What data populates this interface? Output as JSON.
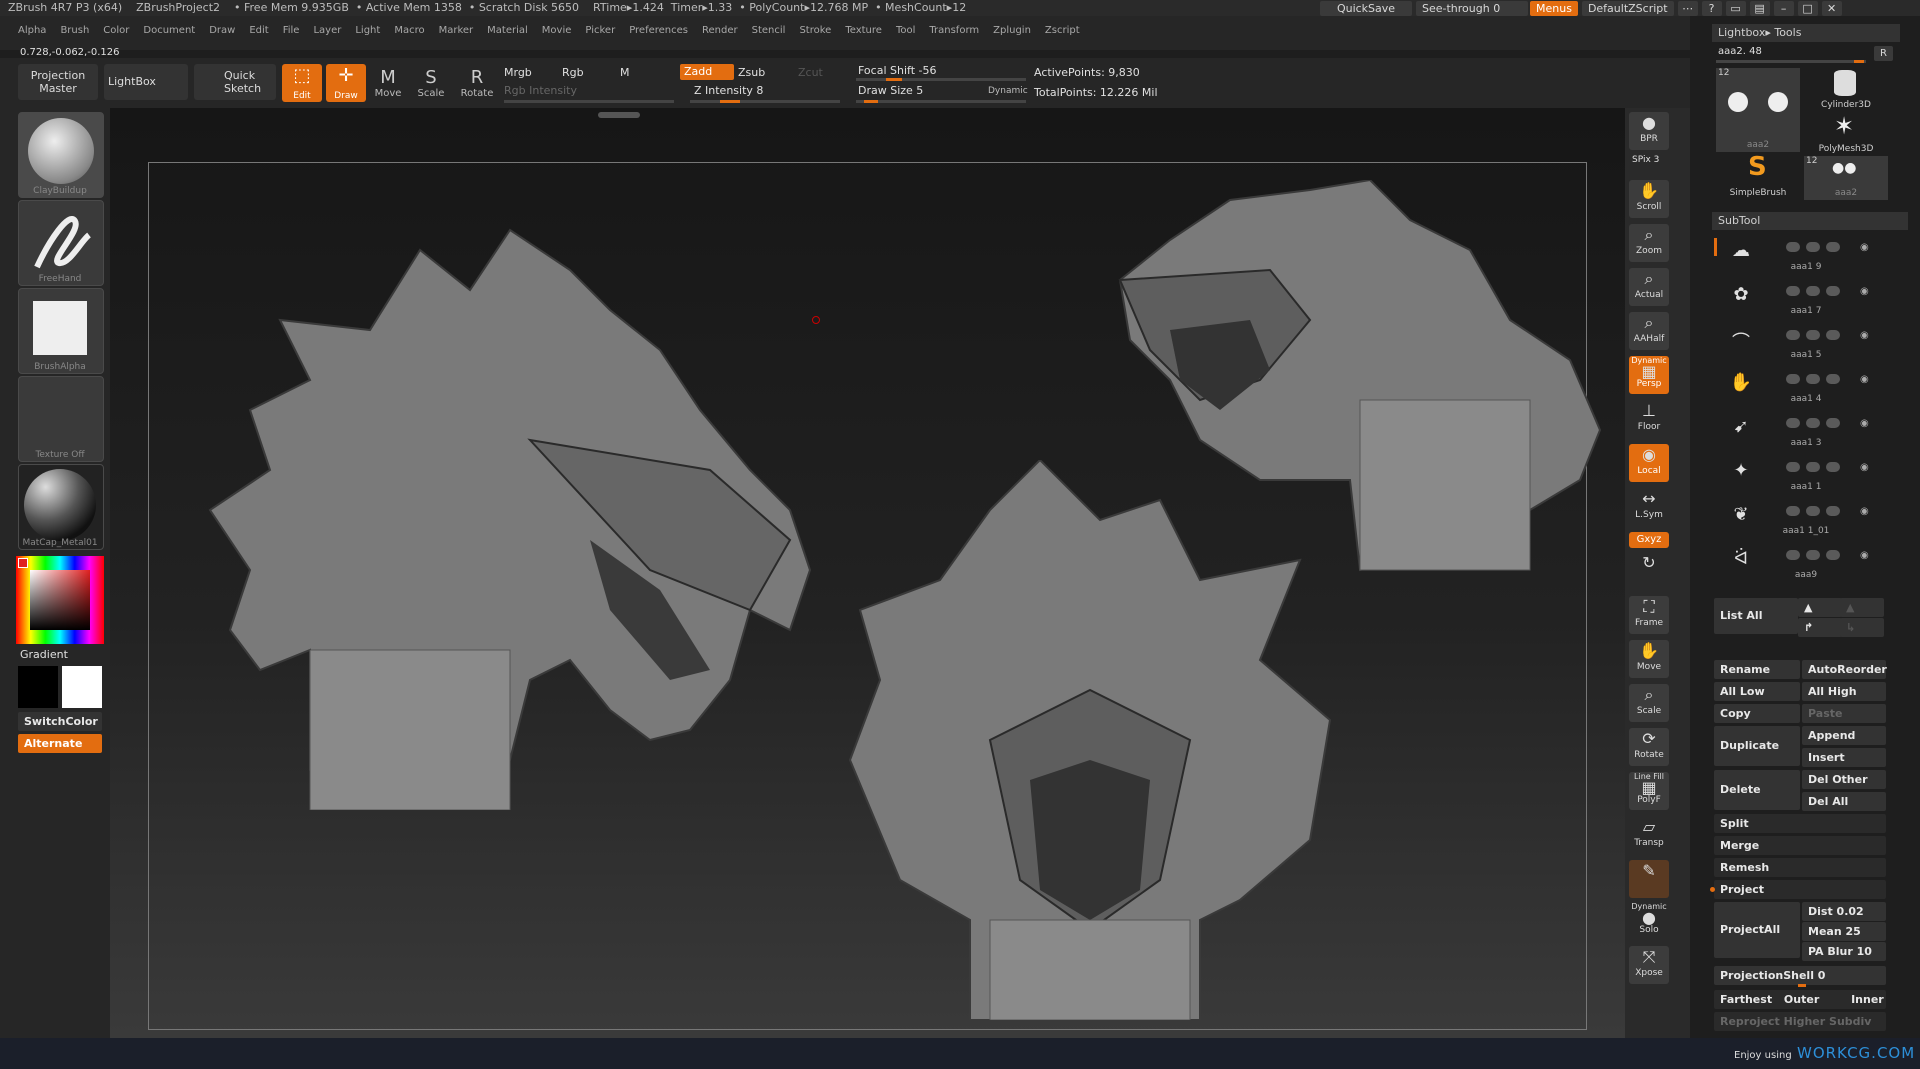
{
  "titlebar": {
    "title": "ZBrush 4R7 P3 (x64)    ZBrushProject2    • Free Mem 9.935GB  • Active Mem 1358  • Scratch Disk 5650    RTime▸1.424  Timer▸1.33  • PolyCount▸12.768 MP  • MeshCount▸12",
    "quicksave": "QuickSave",
    "seethrough": "See-through  0",
    "menus": "Menus",
    "script": "DefaultZScript"
  },
  "menubar": {
    "items": [
      "Alpha",
      "Brush",
      "Color",
      "Document",
      "Draw",
      "Edit",
      "File",
      "Layer",
      "Light",
      "Macro",
      "Marker",
      "Material",
      "Movie",
      "Picker",
      "Preferences",
      "Render",
      "Stencil",
      "Stroke",
      "Texture",
      "Tool",
      "Transform",
      "Zplugin",
      "Zscript"
    ],
    "coords": "0.728,-0.062,-0.126"
  },
  "toolbar": {
    "projection_master": "Projection Master",
    "lightbox": "LightBox",
    "quick_sketch": "Quick Sketch",
    "edit": "Edit",
    "draw": "Draw",
    "move": "Move",
    "scale": "Scale",
    "rotate": "Rotate",
    "mrgb": "Mrgb",
    "rgb": "Rgb",
    "m": "M",
    "rgb_intensity": "Rgb Intensity",
    "zadd": "Zadd",
    "zsub": "Zsub",
    "zcut": "Zcut",
    "z_intensity": "Z Intensity 8",
    "focal_shift": "Focal Shift -56",
    "draw_size": "Draw Size 5",
    "dynamic": "Dynamic",
    "active_points": "ActivePoints: 9,830",
    "total_points": "TotalPoints: 12.226 Mil"
  },
  "leftshelf": {
    "brush": "ClayBuildup",
    "stroke": "FreeHand",
    "alpha": "BrushAlpha",
    "texture": "Texture Off",
    "material": "MatCap_Metal01",
    "gradient": "Gradient",
    "switchcolor": "SwitchColor",
    "alternate": "Alternate"
  },
  "rightshelf": {
    "bpr": "BPR",
    "spix": "SPix 3",
    "scroll": "Scroll",
    "zoom": "Zoom",
    "actual": "Actual",
    "aahalf": "AAHalf",
    "dynamic": "Dynamic",
    "persp": "Persp",
    "floor": "Floor",
    "local": "Local",
    "lsym": "L.Sym",
    "xyz": "Gxyz",
    "frame": "Frame",
    "move": "Move",
    "scale": "Scale",
    "rotate": "Rotate",
    "linefill": "Line Fill",
    "polyf": "PolyF",
    "transp": "Transp",
    "dynamic2": "Dynamic",
    "solo": "Solo",
    "xpose": "Xpose"
  },
  "lightbox_tools": {
    "header": "Lightbox▸ Tools",
    "current": "aaa2. 48",
    "r": "R",
    "tools": [
      {
        "name": "aaa2",
        "count": "12"
      },
      {
        "name": "Cylinder3D"
      },
      {
        "name": "PolyMesh3D"
      },
      {
        "name": "SimpleBrush"
      },
      {
        "name": "aaa2",
        "count": "12"
      }
    ]
  },
  "subtool": {
    "header": "SubTool",
    "items": [
      "aaa1 9",
      "aaa1 7",
      "aaa1 5",
      "aaa1 4",
      "aaa1 3",
      "aaa1 1",
      "aaa1 1_01",
      "aaa9"
    ],
    "list_all": "List All",
    "rename": "Rename",
    "autoreorder": "AutoReorder",
    "all_low": "All Low",
    "all_high": "All High",
    "copy": "Copy",
    "paste": "Paste",
    "duplicate": "Duplicate",
    "append": "Append",
    "insert": "Insert",
    "delete": "Delete",
    "del_other": "Del Other",
    "del_all": "Del All",
    "split": "Split",
    "merge": "Merge",
    "remesh": "Remesh",
    "project": "Project",
    "projectall": "ProjectAll",
    "dist": "Dist 0.02",
    "mean": "Mean 25",
    "pa_blur": "PA Blur 10",
    "projectionshell": "ProjectionShell 0",
    "farthest": "Farthest",
    "outer": "Outer",
    "inner": "Inner",
    "reproject": "Reproject Higher Subdiv"
  },
  "footer": {
    "enjoy": "Enjoy using",
    "brand": "WORKCG.COM"
  },
  "colors": {
    "accent": "#e36d10",
    "panel": "#262626",
    "brand": "#2d8fd8"
  }
}
